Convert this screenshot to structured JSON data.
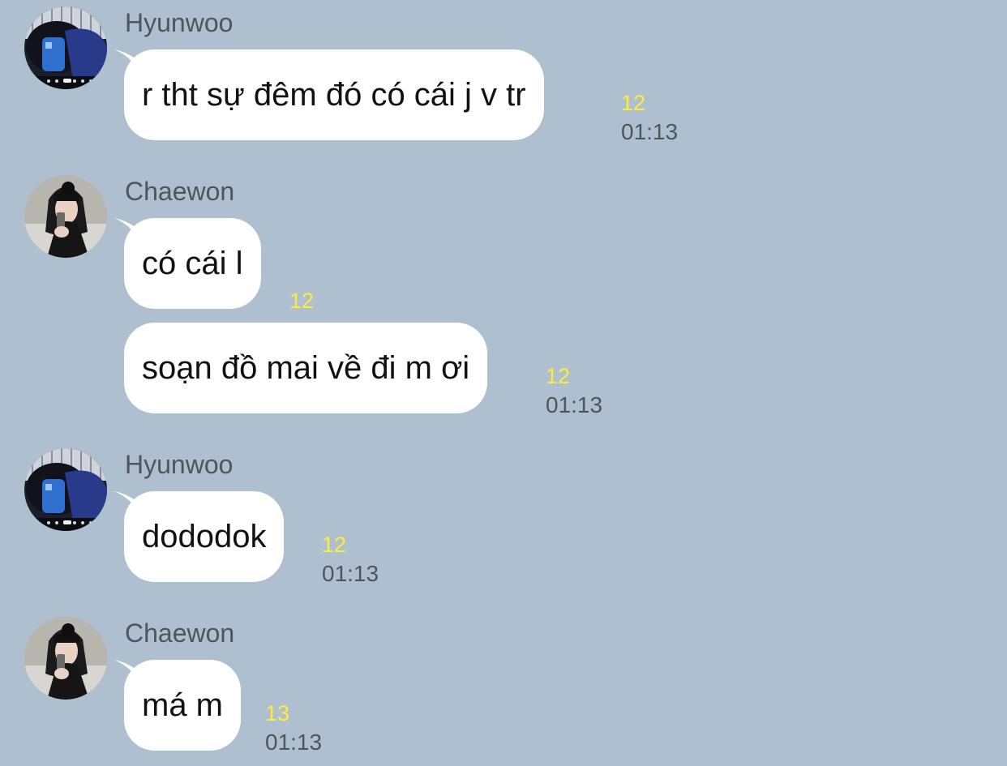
{
  "colors": {
    "background": "#aec0cf",
    "bubble": "#ffffff",
    "unread": "#ffeb3b",
    "meta_text": "#4d5560"
  },
  "groups": [
    {
      "sender": "Hyunwoo",
      "avatar_icon": "avatar-hyunwoo-icon",
      "messages": [
        {
          "text": "r tht sự đêm đó có cái j v tr",
          "unread": "12",
          "time": "01:13"
        }
      ]
    },
    {
      "sender": "Chaewon",
      "avatar_icon": "avatar-chaewon-icon",
      "messages": [
        {
          "text": "có cái l",
          "unread": "12",
          "time": ""
        },
        {
          "text": "soạn đồ mai về đi m ơi",
          "unread": "12",
          "time": "01:13"
        }
      ]
    },
    {
      "sender": "Hyunwoo",
      "avatar_icon": "avatar-hyunwoo-icon",
      "messages": [
        {
          "text": "dododok",
          "unread": "12",
          "time": "01:13"
        }
      ]
    },
    {
      "sender": "Chaewon",
      "avatar_icon": "avatar-chaewon-icon",
      "messages": [
        {
          "text": "má m",
          "unread": "13",
          "time": "01:13"
        }
      ]
    }
  ]
}
